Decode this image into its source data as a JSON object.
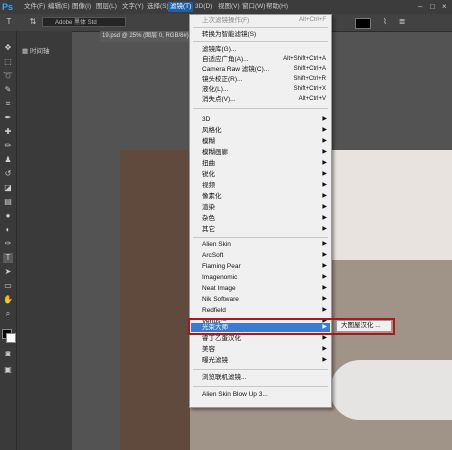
{
  "app": {
    "logo": "Ps",
    "menus": [
      "文件(F)",
      "编辑(E)",
      "图像(I)",
      "图层(L)",
      "文字(Y)",
      "选择(S)",
      "滤镜(T)",
      "3D(D)",
      "视图(V)",
      "窗口(W)",
      "帮助(H)"
    ],
    "active_menu_index": 6
  },
  "options_bar": {
    "font_value": "Adobe 黑体 Std"
  },
  "panels": {
    "timeline_label": "时间轴"
  },
  "document": {
    "tab_label": "19.psd @ 25% (图层 0, RGB/8#)"
  },
  "filter_menu": {
    "top": [
      {
        "label": "上次滤镜操作(F)",
        "shortcut": "Alt+Ctrl+F",
        "disabled": true
      },
      {
        "label": "转换为智能滤镜(S)"
      }
    ],
    "group2": [
      {
        "label": "滤镜库(G)..."
      },
      {
        "label": "自适应广角(A)...",
        "shortcut": "Alt+Shift+Ctrl+A"
      },
      {
        "label": "Camera Raw 滤镜(C)...",
        "shortcut": "Shift+Ctrl+A"
      },
      {
        "label": "镜头校正(R)...",
        "shortcut": "Shift+Ctrl+R"
      },
      {
        "label": "液化(L)...",
        "shortcut": "Shift+Ctrl+X"
      },
      {
        "label": "消失点(V)...",
        "shortcut": "Alt+Ctrl+V"
      }
    ],
    "group3": [
      "3D",
      "风格化",
      "模糊",
      "模糊画廊",
      "扭曲",
      "锐化",
      "视频",
      "像素化",
      "渲染",
      "杂色",
      "其它"
    ],
    "plugins": [
      "Alien Skin",
      "ArcSoft",
      "Flaming Pear",
      "Imagenomic",
      "Neat Image",
      "Nik Software",
      "Redfield",
      "Vertus™"
    ],
    "highlighted": "光束大师",
    "plugins_after": [
      "睿丁乙蛋汉化",
      "美容",
      "曝光滤镜"
    ],
    "browse": "浏览联机滤镜...",
    "last": "Alien Skin Blow Up 3..."
  },
  "submenu": {
    "item": "大图屋汉化 ..."
  },
  "colors": {
    "highlight": "#3b7bd4",
    "annotation_box": "#b3131a"
  }
}
